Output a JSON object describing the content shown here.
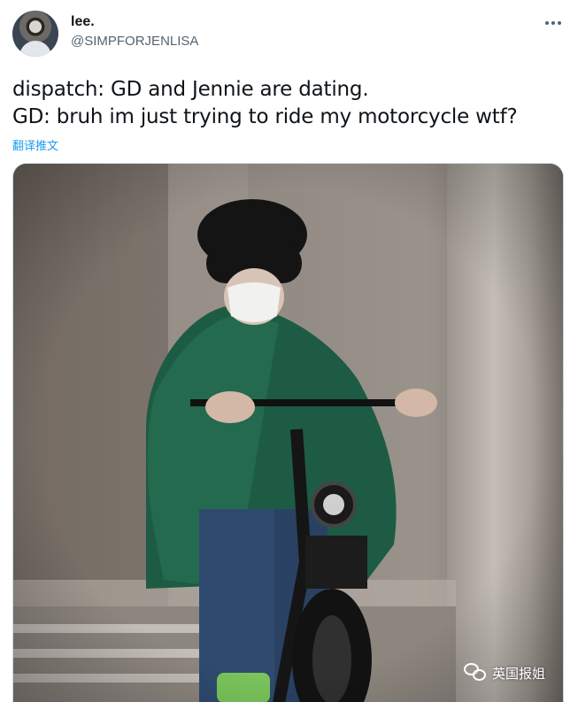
{
  "tweet": {
    "display_name": "lee.",
    "handle": "@SIMPFORJENLISA",
    "text_lines": [
      "dispatch: GD and Jennie are dating.",
      "GD: bruh im just trying to ride my motorcycle wtf?"
    ],
    "translate_label": "翻译推文"
  },
  "media": {
    "watermark_text": "英国报姐",
    "alt_icon": "wechat-icon"
  },
  "colors": {
    "link": "#1d9bf0",
    "secondary_text": "#536471",
    "primary_text": "#0f1419"
  },
  "icons": {
    "more": "more-horizontal-icon"
  }
}
